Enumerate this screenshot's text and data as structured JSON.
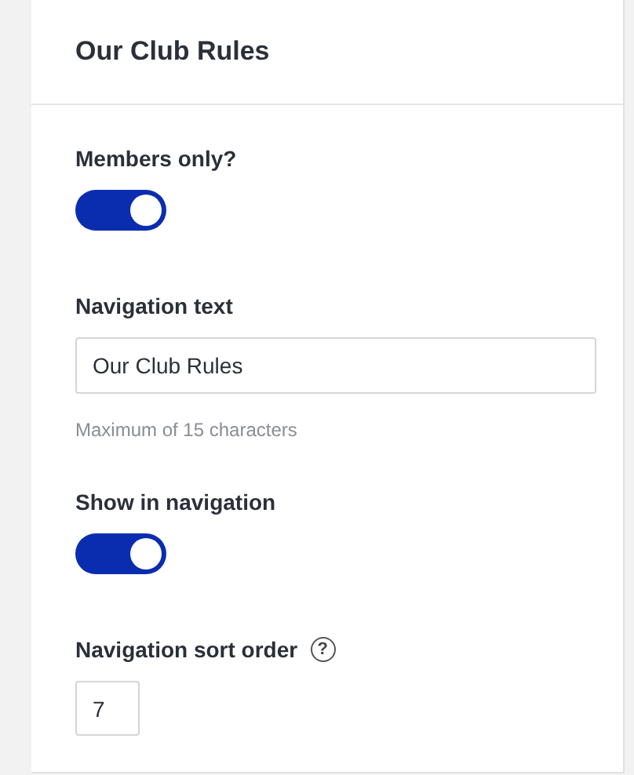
{
  "panel": {
    "title": "Our Club Rules"
  },
  "fields": [
    {
      "kind": "toggle",
      "label": "Members only?",
      "on": true
    },
    {
      "kind": "text",
      "label": "Navigation text",
      "value": "Our Club Rules",
      "hint": "Maximum of 15 characters"
    },
    {
      "kind": "toggle",
      "label": "Show in navigation",
      "on": true
    },
    {
      "kind": "number",
      "label": "Navigation sort order",
      "value": "7",
      "help": "?"
    }
  ]
}
